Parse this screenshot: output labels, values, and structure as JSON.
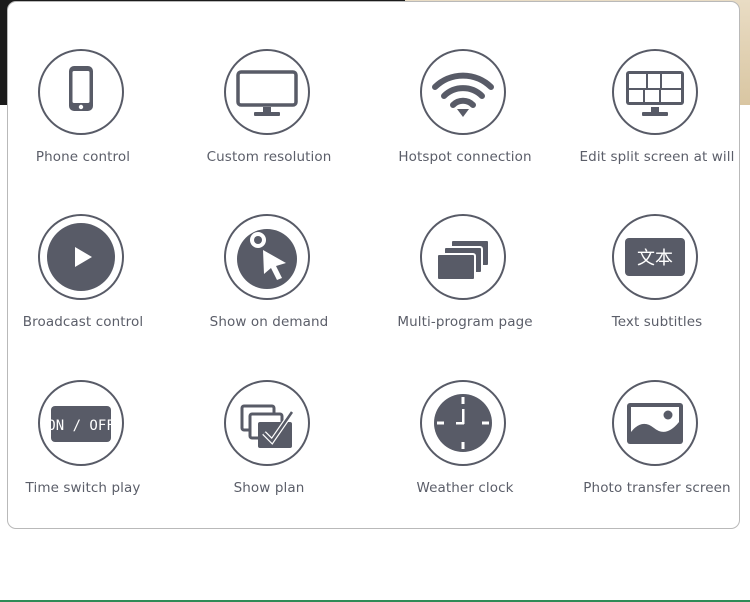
{
  "features": [
    {
      "label": "Phone control",
      "icon": "phone-icon"
    },
    {
      "label": "Custom resolution",
      "icon": "monitor-icon"
    },
    {
      "label": "Hotspot connection",
      "icon": "wifi-icon"
    },
    {
      "label": "Edit split screen at will",
      "icon": "split-screen-monitor-icon"
    },
    {
      "label": "Broadcast control",
      "icon": "play-icon"
    },
    {
      "label": "Show on demand",
      "icon": "cursor-pointer-icon"
    },
    {
      "label": "Multi-program page",
      "icon": "stacked-pages-icon"
    },
    {
      "label": "Text subtitles",
      "icon": "text-subtitle-icon",
      "glyph": "文本"
    },
    {
      "label": "Time switch play",
      "icon": "on-off-icon",
      "glyph": "ON / OFF"
    },
    {
      "label": "Show plan",
      "icon": "checklist-icon"
    },
    {
      "label": "Weather clock",
      "icon": "clock-icon"
    },
    {
      "label": "Photo transfer screen",
      "icon": "image-icon"
    }
  ],
  "colors": {
    "icon": "#585b67",
    "label": "#5b5e69",
    "border": "#b9b9b9"
  }
}
